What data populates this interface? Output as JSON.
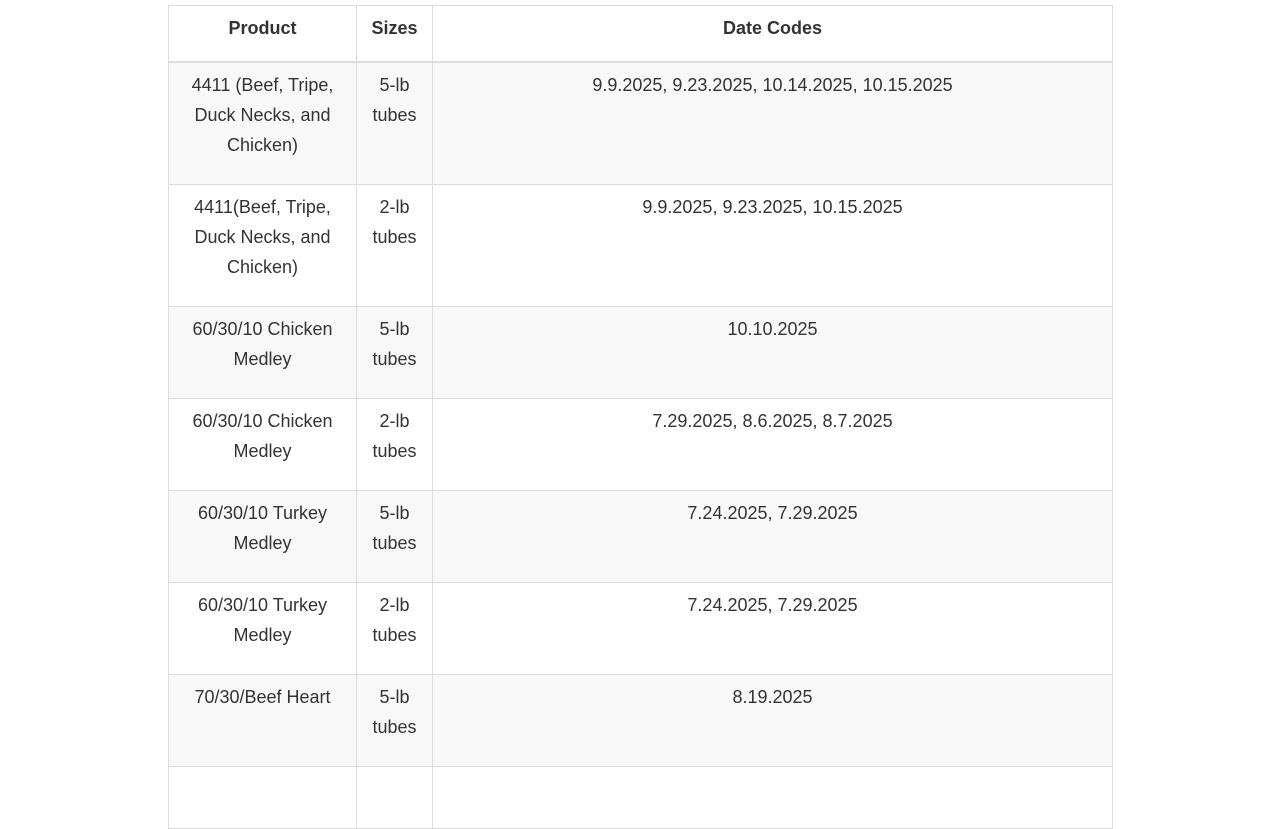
{
  "table": {
    "headers": {
      "product": "Product",
      "sizes": "Sizes",
      "date_codes": "Date Codes"
    },
    "rows": [
      {
        "product": "4411 (Beef, Tripe, Duck Necks, and Chicken)",
        "sizes": "5-lb tubes",
        "date_codes": "9.9.2025, 9.23.2025, 10.14.2025, 10.15.2025"
      },
      {
        "product": "4411(Beef, Tripe, Duck Necks, and Chicken)",
        "sizes": "2-lb tubes",
        "date_codes": "9.9.2025, 9.23.2025, 10.15.2025"
      },
      {
        "product": "60/30/10 Chicken Medley",
        "sizes": "5-lb tubes",
        "date_codes": "10.10.2025"
      },
      {
        "product": "60/30/10 Chicken Medley",
        "sizes": "2-lb tubes",
        "date_codes": "7.29.2025, 8.6.2025, 8.7.2025"
      },
      {
        "product": "60/30/10 Turkey Medley",
        "sizes": "5-lb tubes",
        "date_codes": "7.24.2025, 7.29.2025"
      },
      {
        "product": "60/30/10 Turkey Medley",
        "sizes": "2-lb tubes",
        "date_codes": "7.24.2025, 7.29.2025"
      },
      {
        "product": "70/30/Beef Heart",
        "sizes": "5-lb tubes",
        "date_codes": "8.19.2025"
      },
      {
        "product": "",
        "sizes": "",
        "date_codes": ""
      }
    ]
  }
}
